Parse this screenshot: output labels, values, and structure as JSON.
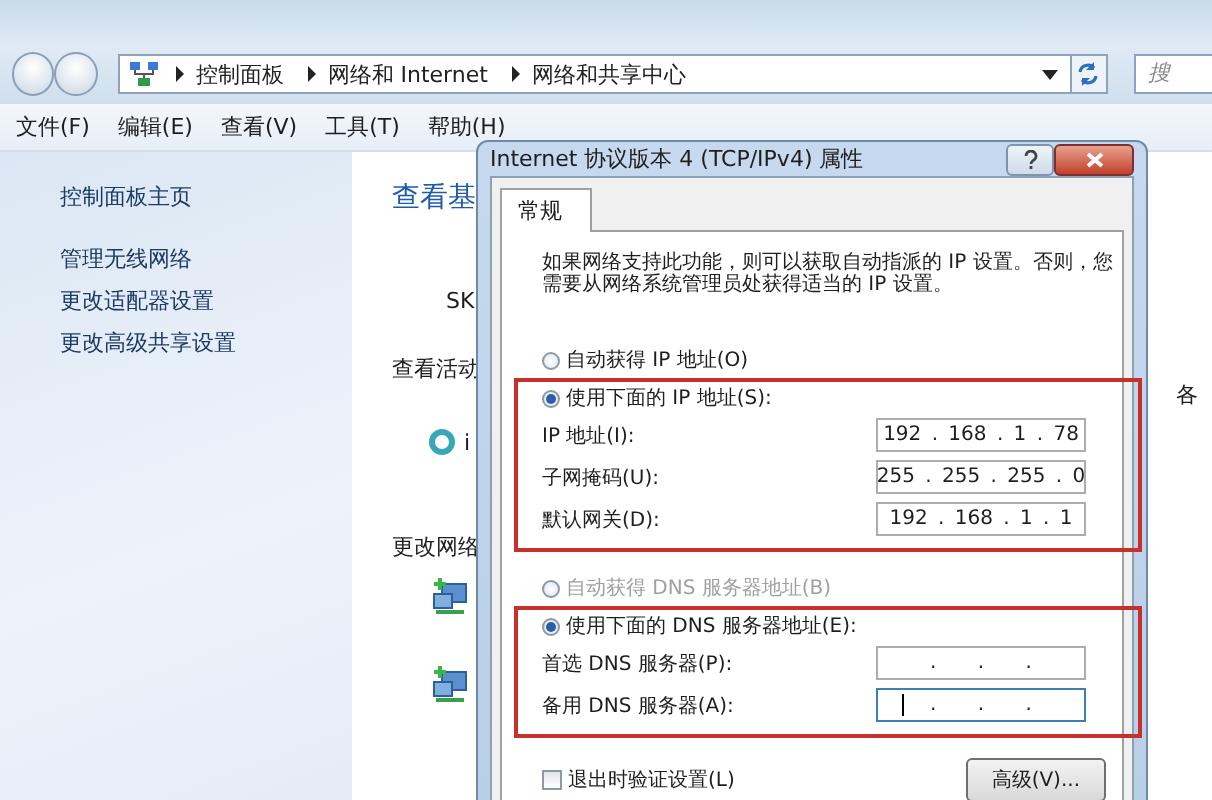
{
  "nav": {
    "breadcrumbs": [
      "控制面板",
      "网络和 Internet",
      "网络和共享中心"
    ],
    "search_placeholder": "搜"
  },
  "menu": [
    "文件(F)",
    "编辑(E)",
    "查看(V)",
    "工具(T)",
    "帮助(H)"
  ],
  "sidebar": {
    "title": "控制面板主页",
    "links": [
      "管理无线网络",
      "更改适配器设置",
      "更改高级共享设置"
    ]
  },
  "main": {
    "heading": "查看基",
    "network_name": "SK",
    "active_label": "查看活动",
    "active_item": "i",
    "change_label": "更改网络",
    "right_fragment": "各"
  },
  "dialog": {
    "title": "Internet 协议版本 4 (TCP/IPv4) 属性",
    "tabs": [
      {
        "label": "常规",
        "selected": true
      }
    ],
    "description": "如果网络支持此功能，则可以获取自动指派的 IP 设置。否则，您需要从网络系统管理员处获得适当的 IP 设置。",
    "ip_modes": [
      {
        "label": "自动获得 IP 地址(O)",
        "selected": false,
        "disabled": false
      },
      {
        "label": "使用下面的 IP 地址(S):",
        "selected": true,
        "disabled": false
      }
    ],
    "ip_fields": [
      {
        "label": "IP 地址(I):",
        "value": "192 . 168 . 1 . 78",
        "focused": false
      },
      {
        "label": "子网掩码(U):",
        "value": "255 . 255 . 255 . 0",
        "focused": false
      },
      {
        "label": "默认网关(D):",
        "value": "192 . 168 . 1 . 1",
        "focused": false
      }
    ],
    "dns_modes": [
      {
        "label": "自动获得 DNS 服务器地址(B)",
        "selected": false,
        "disabled": true
      },
      {
        "label": "使用下面的 DNS 服务器地址(E):",
        "selected": true,
        "disabled": false
      }
    ],
    "dns_fields": [
      {
        "label": "首选 DNS 服务器(P):",
        "value": ".    .    .",
        "focused": false
      },
      {
        "label": "备用 DNS 服务器(A):",
        "value": ".    .    .",
        "focused": true
      }
    ],
    "validate": {
      "label": "退出时验证设置(L)",
      "checked": false
    },
    "advanced_button": "高级(V)..."
  }
}
